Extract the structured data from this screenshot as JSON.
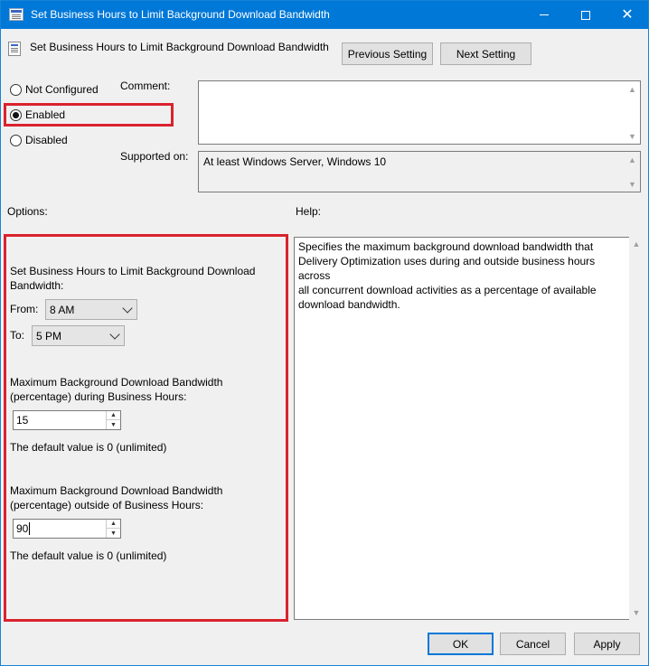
{
  "window": {
    "title": "Set Business Hours to Limit Background Download Bandwidth",
    "controls": {
      "minimize": "—",
      "maximize": "☐",
      "close": "✕"
    },
    "accent_color": "#0078d7"
  },
  "header": {
    "title": "Set Business Hours to Limit Background Download Bandwidth",
    "previous_label": "Previous Setting",
    "next_label": "Next Setting"
  },
  "state": {
    "options": [
      {
        "label": "Not Configured",
        "checked": false
      },
      {
        "label": "Enabled",
        "checked": true
      },
      {
        "label": "Disabled",
        "checked": false
      }
    ]
  },
  "comment": {
    "label": "Comment:",
    "value": ""
  },
  "supported": {
    "label": "Supported on:",
    "value": "At least Windows Server, Windows 10"
  },
  "options_section": {
    "label": "Options:",
    "business_hours_label": "Set Business Hours to Limit Background Download Bandwidth:",
    "business_hours_line1": "Set Business Hours to Limit Background Download",
    "business_hours_line2": "Bandwidth:",
    "from_label": "From:",
    "from_value": "8 AM",
    "to_label": "To:",
    "to_value": "5 PM",
    "during_line1": "Maximum Background Download Bandwidth",
    "during_line2": "(percentage) during Business Hours:",
    "during_value": "15",
    "during_default": "The default value is 0 (unlimited)",
    "outside_line1": "Maximum Background Download Bandwidth",
    "outside_line2": "(percentage) outside of Business Hours:",
    "outside_value": "90",
    "outside_default": "The default value is 0 (unlimited)"
  },
  "help": {
    "label": "Help:",
    "text": "Specifies the maximum background download bandwidth that\nDelivery Optimization uses during and outside business hours across\nall concurrent download activities as a percentage of available\ndownload bandwidth."
  },
  "footer": {
    "ok_label": "OK",
    "cancel_label": "Cancel",
    "apply_label": "Apply"
  },
  "highlight_color": "#d9232e"
}
